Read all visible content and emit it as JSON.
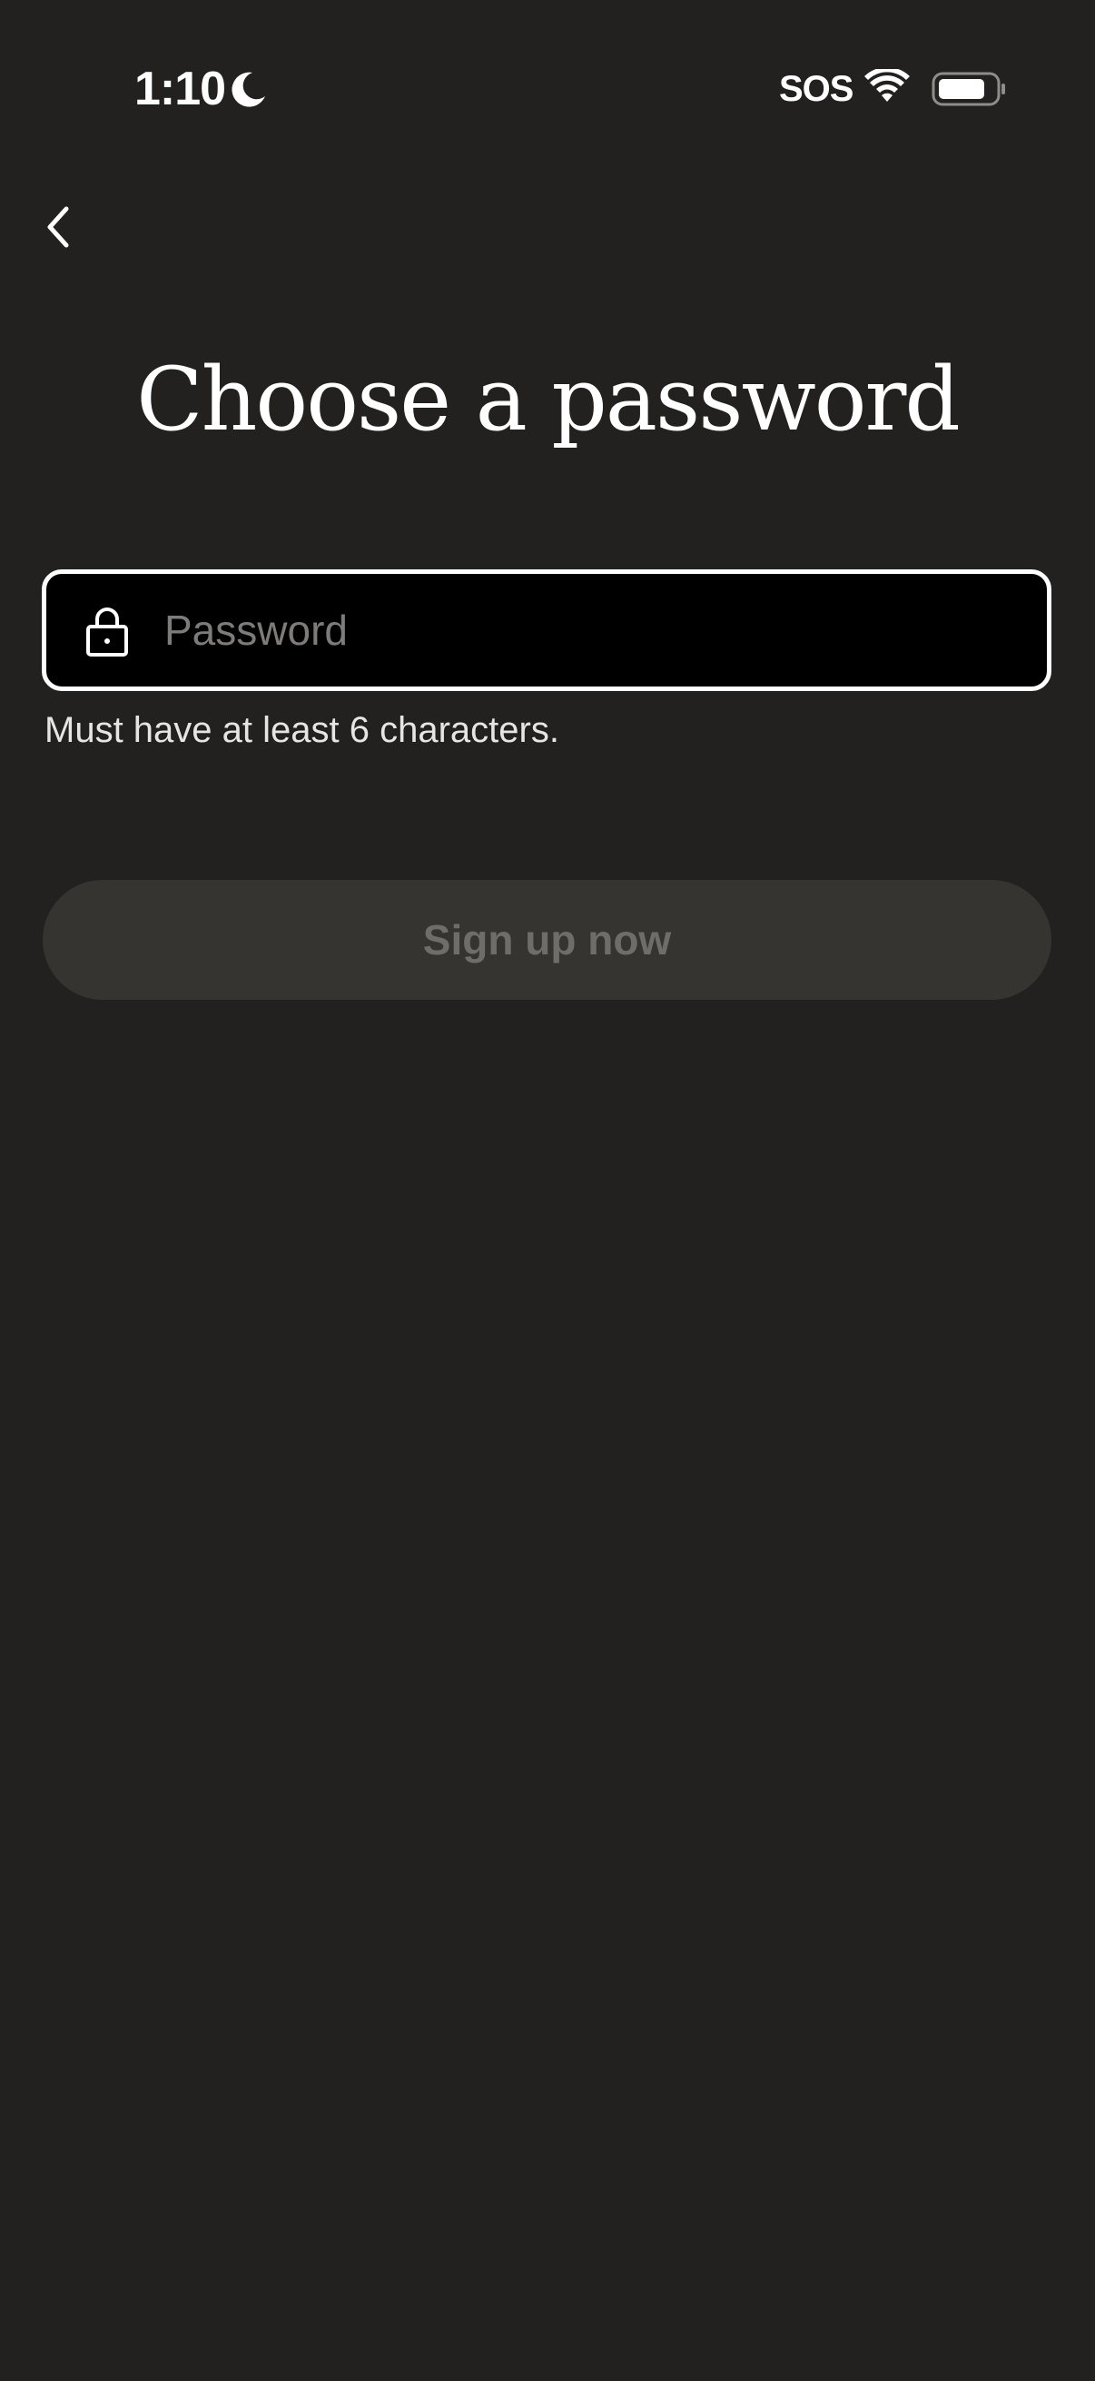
{
  "status_bar": {
    "time": "1:10",
    "carrier": "SOS",
    "icons": [
      "moon-icon",
      "wifi-icon",
      "battery-icon"
    ]
  },
  "nav": {
    "back_icon": "chevron-left-icon"
  },
  "title": "Choose a password",
  "password_field": {
    "icon": "lock-icon",
    "placeholder": "Password",
    "value": ""
  },
  "helper_text": "Must have at least 6 characters.",
  "signup_button": {
    "label": "Sign up now",
    "enabled": false
  },
  "colors": {
    "background": "#222120",
    "field_background": "#000000",
    "field_border": "#ffffff",
    "placeholder": "#7d7c7a",
    "button_disabled_bg": "#353431",
    "button_disabled_text": "#6e6d6a"
  }
}
